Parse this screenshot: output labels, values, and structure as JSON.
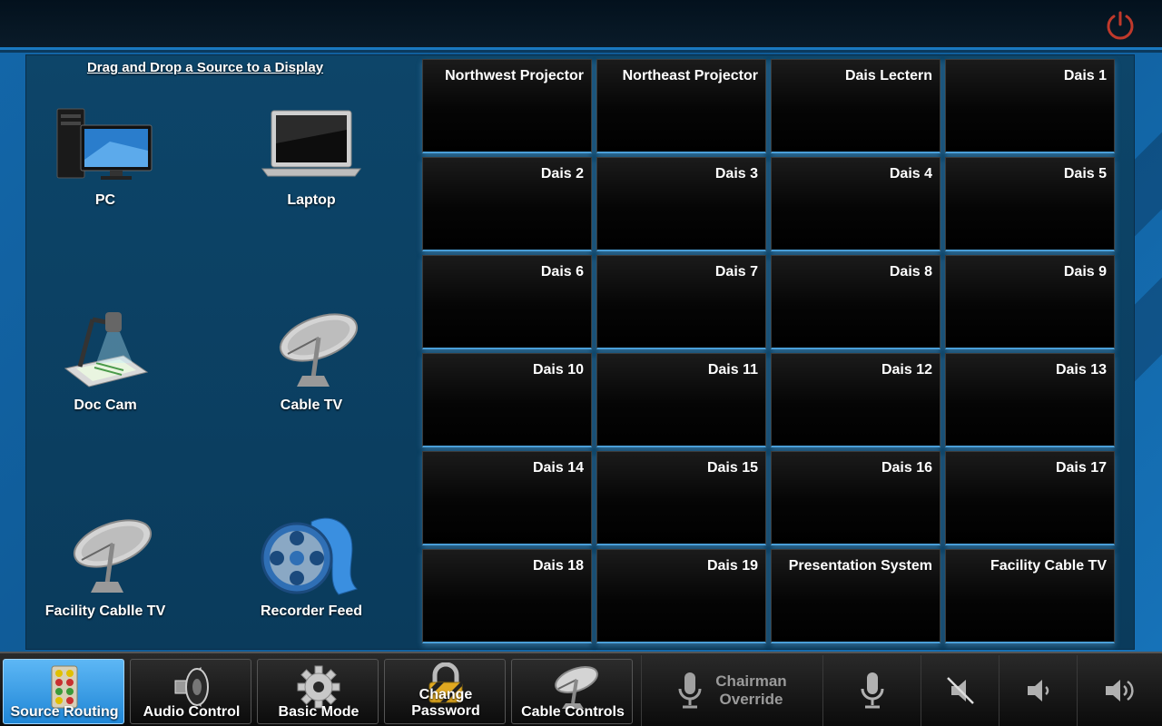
{
  "panel": {
    "title": "Drag and Drop a Source to a Display"
  },
  "sources": [
    {
      "label": "PC",
      "icon": "pc-icon"
    },
    {
      "label": "Laptop",
      "icon": "laptop-icon"
    },
    {
      "label": "Doc Cam",
      "icon": "doc-cam-icon"
    },
    {
      "label": "Cable TV",
      "icon": "satellite-dish-icon"
    },
    {
      "label": "Facility Cablle TV",
      "icon": "satellite-dish-icon"
    },
    {
      "label": "Recorder Feed",
      "icon": "film-reel-icon"
    }
  ],
  "displays": [
    "Northwest Projector",
    "Northeast Projector",
    "Dais Lectern",
    "Dais 1",
    "Dais 2",
    "Dais 3",
    "Dais 4",
    "Dais 5",
    "Dais 6",
    "Dais 7",
    "Dais 8",
    "Dais 9",
    "Dais 10",
    "Dais 11",
    "Dais 12",
    "Dais 13",
    "Dais 14",
    "Dais 15",
    "Dais 16",
    "Dais 17",
    "Dais 18",
    "Dais 19",
    "Presentation System",
    "Facility Cable TV"
  ],
  "nav": {
    "source_routing": "Source Routing",
    "audio_control": "Audio Control",
    "basic_mode": "Basic Mode",
    "change_password_line1": "Change",
    "change_password_line2": "Password",
    "cable_controls": "Cable Controls",
    "chairman_line1": "Chairman",
    "chairman_line2": "Override"
  },
  "active_tab": "Source Routing",
  "colors": {
    "accent": "#1f86d6",
    "tile_edge": "#4a9fd8",
    "power": "#c0392b"
  }
}
